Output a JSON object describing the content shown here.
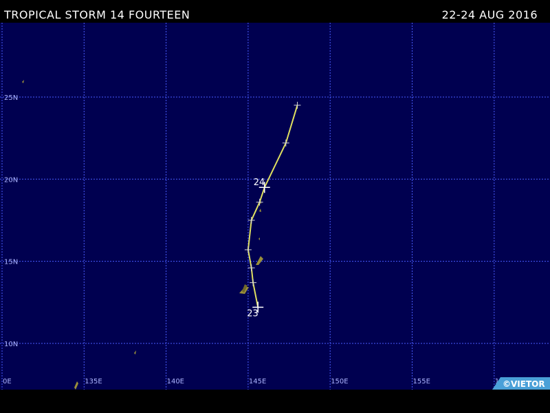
{
  "header": {
    "title": "TROPICAL STORM 14 FOURTEEN",
    "dates": "22-24 AUG 2016"
  },
  "map": {
    "background_color": "#000050",
    "grid_color": "#4a5cff",
    "land_color": "#9a8f3a",
    "track_color": "#e0e060",
    "lat_labels": [
      {
        "label": "25N",
        "lat": 25
      },
      {
        "label": "20N",
        "lat": 20
      },
      {
        "label": "15N",
        "lat": 15
      },
      {
        "label": "10N",
        "lat": 10
      }
    ],
    "lon_labels": [
      {
        "label": "0E",
        "lon": 130
      },
      {
        "label": "135E",
        "lon": 135
      },
      {
        "label": "140E",
        "lon": 140
      },
      {
        "label": "145E",
        "lon": 145
      },
      {
        "label": "150E",
        "lon": 150
      },
      {
        "label": "155E",
        "lon": 155
      },
      {
        "label": "160E",
        "lon": 160
      }
    ]
  },
  "track": {
    "points": [
      {
        "lon": 145.6,
        "lat": 12.2
      },
      {
        "lon": 145.3,
        "lat": 13.7
      },
      {
        "lon": 145.2,
        "lat": 14.6
      },
      {
        "lon": 145.0,
        "lat": 15.7
      },
      {
        "lon": 145.2,
        "lat": 17.5
      },
      {
        "lon": 145.7,
        "lat": 18.6
      },
      {
        "lon": 146.0,
        "lat": 19.5
      },
      {
        "lon": 147.3,
        "lat": 22.2
      },
      {
        "lon": 148.0,
        "lat": 24.5
      }
    ],
    "date_markers": [
      {
        "label": "23",
        "lon": 145.6,
        "lat": 12.2
      },
      {
        "label": "24",
        "lon": 146.0,
        "lat": 19.5
      }
    ]
  },
  "credit": "©VIETOR"
}
